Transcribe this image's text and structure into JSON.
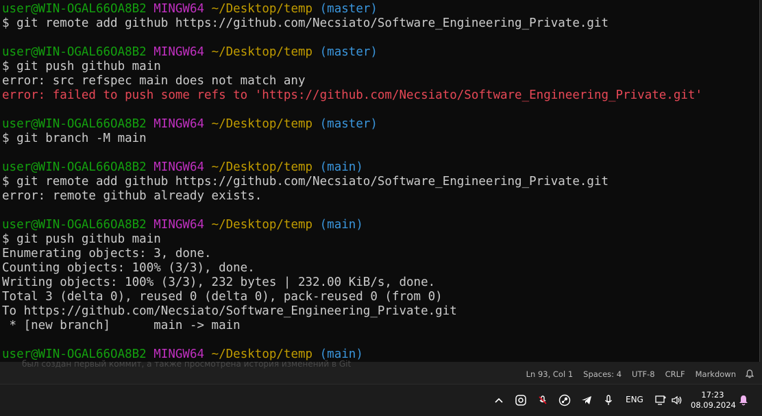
{
  "prompt": {
    "user": "user@WIN-OGAL66OA8B2",
    "shell": "MINGW64",
    "path": "~/Desktop/temp"
  },
  "terminal_lines": [
    {
      "type": "prompt",
      "branch": "(master)"
    },
    {
      "type": "command",
      "text": "$ git remote add github https://github.com/Necsiato/Software_Engineering_Private.git"
    },
    {
      "type": "blank"
    },
    {
      "type": "prompt",
      "branch": "(master)"
    },
    {
      "type": "command",
      "text": "$ git push github main"
    },
    {
      "type": "output",
      "text": "error: src refspec main does not match any"
    },
    {
      "type": "error",
      "text": "error: failed to push some refs to 'https://github.com/Necsiato/Software_Engineering_Private.git'"
    },
    {
      "type": "blank"
    },
    {
      "type": "prompt",
      "branch": "(master)"
    },
    {
      "type": "command",
      "text": "$ git branch -M main"
    },
    {
      "type": "blank"
    },
    {
      "type": "prompt",
      "branch": "(main)"
    },
    {
      "type": "command",
      "text": "$ git remote add github https://github.com/Necsiato/Software_Engineering_Private.git"
    },
    {
      "type": "output",
      "text": "error: remote github already exists."
    },
    {
      "type": "blank"
    },
    {
      "type": "prompt",
      "branch": "(main)"
    },
    {
      "type": "command",
      "text": "$ git push github main"
    },
    {
      "type": "output",
      "text": "Enumerating objects: 3, done."
    },
    {
      "type": "output",
      "text": "Counting objects: 100% (3/3), done."
    },
    {
      "type": "output",
      "text": "Writing objects: 100% (3/3), 232 bytes | 232.00 KiB/s, done."
    },
    {
      "type": "output",
      "text": "Total 3 (delta 0), reused 0 (delta 0), pack-reused 0 (from 0)"
    },
    {
      "type": "output",
      "text": "To https://github.com/Necsiato/Software_Engineering_Private.git"
    },
    {
      "type": "output",
      "text": " * [new branch]      main -> main"
    },
    {
      "type": "blank"
    },
    {
      "type": "prompt",
      "branch": "(main)"
    }
  ],
  "editor": {
    "ghost_text": "был создан первый коммит, а также просмотрена история изменений в Git"
  },
  "statusbar": {
    "position": "Ln 93, Col 1",
    "spaces": "Spaces: 4",
    "encoding": "UTF-8",
    "eol": "CRLF",
    "language": "Markdown"
  },
  "taskbar": {
    "language": "ENG",
    "time": "17:23",
    "date": "08.09.2024"
  },
  "icons": [
    "chevron-up-icon",
    "copilot-icon",
    "mic-muted-icon",
    "steam-icon",
    "telegram-icon",
    "microphone-icon",
    "network-icon",
    "volume-icon",
    "notification-bell-icon"
  ],
  "colors": {
    "terminal_bg": "#0c0c0c",
    "user": "#13a10e",
    "mingw": "#c030c0",
    "path": "#c19c00",
    "branch": "#3a96dd",
    "error": "#e74856",
    "text": "#cccccc"
  }
}
